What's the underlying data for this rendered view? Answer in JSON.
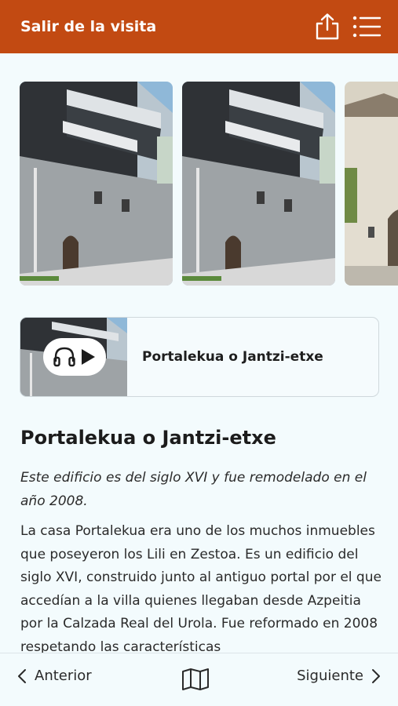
{
  "topbar": {
    "exit_label": "Salir de la visita",
    "share_icon": "share-icon",
    "menu_icon": "list-menu-icon",
    "color": "#c24a12"
  },
  "gallery": {
    "images": [
      "building-photo-1",
      "building-photo-2",
      "building-photo-3"
    ]
  },
  "audio": {
    "title": "Portalekua o Jantzi-etxe",
    "icons": [
      "headphones-icon",
      "play-icon"
    ]
  },
  "article": {
    "heading": "Portalekua o Jantzi-etxe",
    "subtitle": "Este edificio es del siglo XVI y fue remodelado en el año 2008.",
    "body": "La casa Portalekua era uno de los muchos inmuebles que poseyeron los Lili en Zestoa. Es un edificio del siglo XVI, construido junto al antiguo portal por el que accedían a la villa quienes llegaban desde Azpeitia por la Calzada Real del Urola. Fue reformado en 2008 respetando las características"
  },
  "bottom_nav": {
    "prev_label": "Anterior",
    "next_label": "Siguiente",
    "map_icon": "map-icon"
  }
}
